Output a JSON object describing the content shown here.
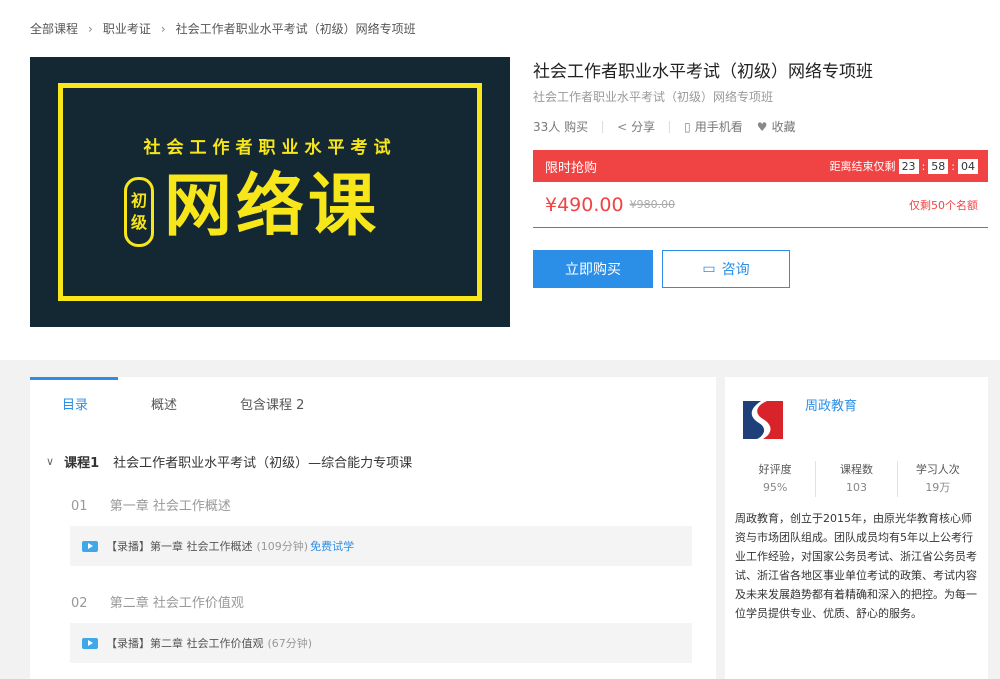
{
  "breadcrumb": [
    "全部课程",
    "职业考证",
    "社会工作者职业水平考试（初级）网络专项班"
  ],
  "banner": {
    "line1": "社会工作者职业水平考试",
    "level_a": "初",
    "level_b": "级",
    "big": "网络课"
  },
  "course": {
    "title": "社会工作者职业水平考试（初级）网络专项班",
    "subtitle": "社会工作者职业水平考试（初级）网络专项班",
    "buyers": "33人 购买",
    "share": "分享",
    "mobile": "用手机看",
    "fav": "收藏"
  },
  "promo": {
    "label": "限时抢购",
    "countdown_label": "距离结束仅剩",
    "h": "23",
    "m": "58",
    "s": "04",
    "price": "¥490.00",
    "original": "¥980.00",
    "limit": "仅剩50个名额"
  },
  "buttons": {
    "buy": "立即购买",
    "ask": "咨询"
  },
  "tabs": [
    "目录",
    "概述",
    "包含课程 2"
  ],
  "catalog": {
    "course_num": "课程1",
    "course_title": "社会工作者职业水平考试（初级）—综合能力专项课",
    "chapters": [
      {
        "num": "01",
        "title": "第一章 社会工作概述",
        "lesson": "【录播】第一章 社会工作概述",
        "duration": "(109分钟)",
        "free": "免费试学"
      },
      {
        "num": "02",
        "title": "第二章 社会工作价值观",
        "lesson": "【录播】第二章 社会工作价值观",
        "duration": "(67分钟)",
        "free": ""
      }
    ]
  },
  "org": {
    "name": "周政教育",
    "stats": [
      {
        "label": "好评度",
        "value": "95%"
      },
      {
        "label": "课程数",
        "value": "103"
      },
      {
        "label": "学习人次",
        "value": "19万"
      }
    ],
    "description": "周政教育，创立于2015年，由原光华教育核心师资与市场团队组成。团队成员均有5年以上公考行业工作经验，对国家公务员考试、浙江省公务员考试、浙江省各地区事业单位考试的政策、考试内容及未来发展趋势都有着精确和深入的把控。为每一位学员提供专业、优质、舒心的服务。"
  },
  "colors": {
    "accent": "#2b8fe8",
    "promo": "#f04444",
    "banner_bg": "#142834",
    "banner_text": "#f6e61a"
  }
}
